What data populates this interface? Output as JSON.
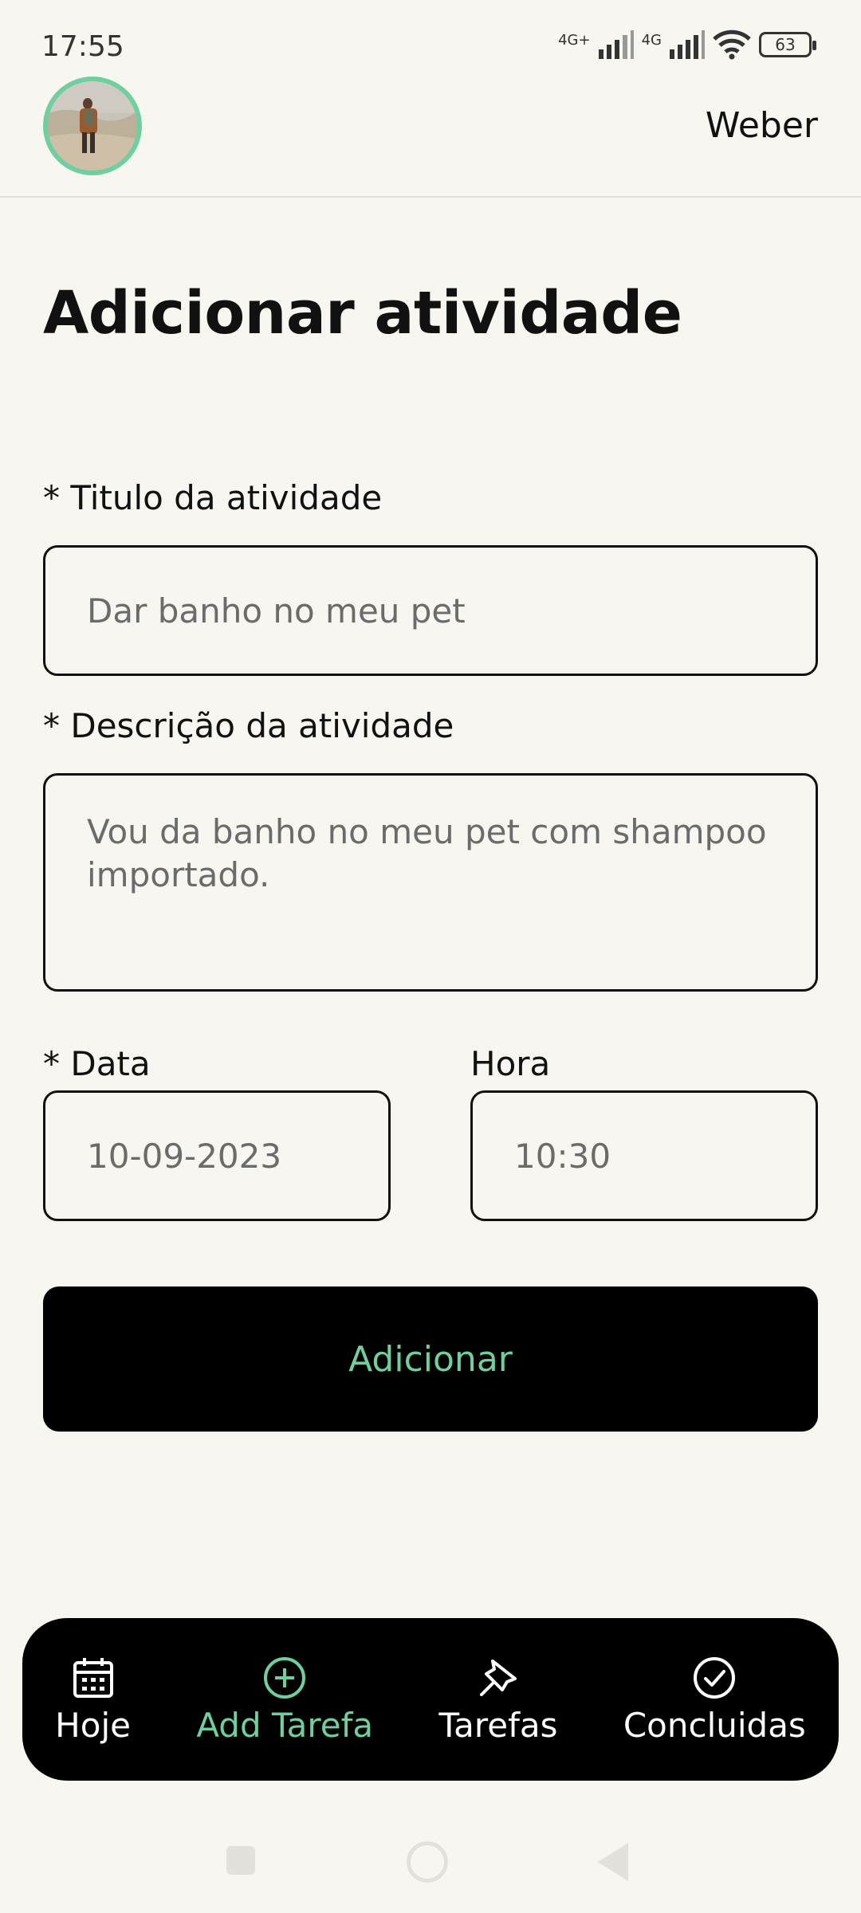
{
  "status_bar": {
    "time": "17:55",
    "network1": "4G+",
    "network2": "4G",
    "battery": "63"
  },
  "header": {
    "user_name": "Weber"
  },
  "form": {
    "title": "Adicionar atividade",
    "title_label": "* Titulo da atividade",
    "title_placeholder": "Dar banho no meu pet",
    "description_label": "* Descrição da atividade",
    "description_placeholder": "Vou da banho no meu pet com shampoo importado.",
    "date_label": "* Data",
    "date_placeholder": "10-09-2023",
    "time_label": "Hora",
    "time_placeholder": "10:30",
    "submit_label": "Adicionar"
  },
  "bottom_nav": {
    "items": [
      {
        "label": "Hoje",
        "icon": "calendar-icon"
      },
      {
        "label": "Add Tarefa",
        "icon": "plus-circle-icon",
        "active": true
      },
      {
        "label": "Tarefas",
        "icon": "pin-icon"
      },
      {
        "label": "Concluidas",
        "icon": "check-circle-icon"
      }
    ]
  },
  "colors": {
    "accent": "#6fcf9f",
    "background": "#f8f6f1",
    "nav_background": "#000000"
  }
}
